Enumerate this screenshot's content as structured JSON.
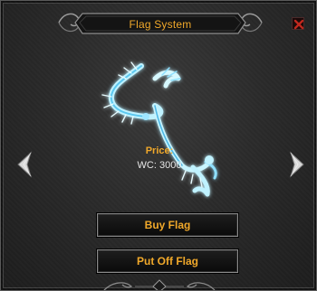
{
  "window": {
    "title": "Flag System",
    "close_icon": "close-x-icon"
  },
  "flag": {
    "icon": "frost-dragon-flag-icon",
    "price_label": "Price:",
    "price_value": "WC: 3000"
  },
  "navigation": {
    "prev_icon": "chevron-left-icon",
    "next_icon": "chevron-right-icon"
  },
  "buttons": {
    "buy_label": "Buy Flag",
    "put_off_label": "Put Off Flag"
  },
  "colors": {
    "accent": "#f0a82a",
    "close_red": "#c0281e",
    "frost": "#9fe6ff"
  }
}
